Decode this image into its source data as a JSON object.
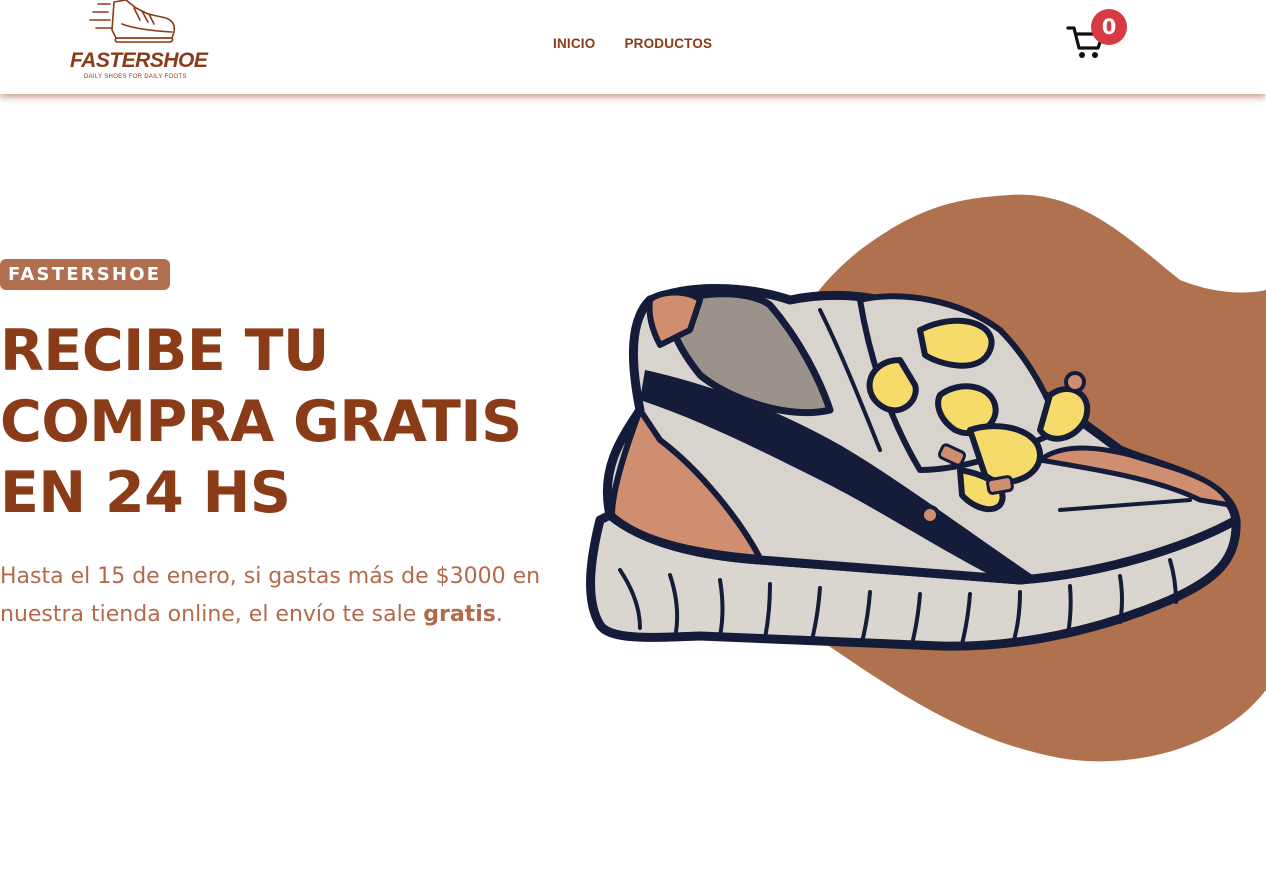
{
  "brand": {
    "name": "FASTERSHOE",
    "tagline": "DAILY SHOES FOR DAILY FOOTS"
  },
  "nav": [
    {
      "label": "INICIO"
    },
    {
      "label": "PRODUCTOS"
    }
  ],
  "cart": {
    "count": "0",
    "icon": "cart-icon"
  },
  "hero": {
    "badge": "FASTERSHOE",
    "headline_lines": [
      "RECIBE TU",
      "COMPRA GRATIS",
      "EN 24 HS"
    ],
    "sub_part1": "Hasta el 15 de enero, si gastas más de $3000  en nuestra tienda online, el envío te sale ",
    "sub_bold": "gratis",
    "sub_end": "."
  },
  "colors": {
    "brand": "#8a3b17",
    "badge": "#b07050",
    "blob": "#b0724e",
    "cart_badge": "#d83a45"
  }
}
